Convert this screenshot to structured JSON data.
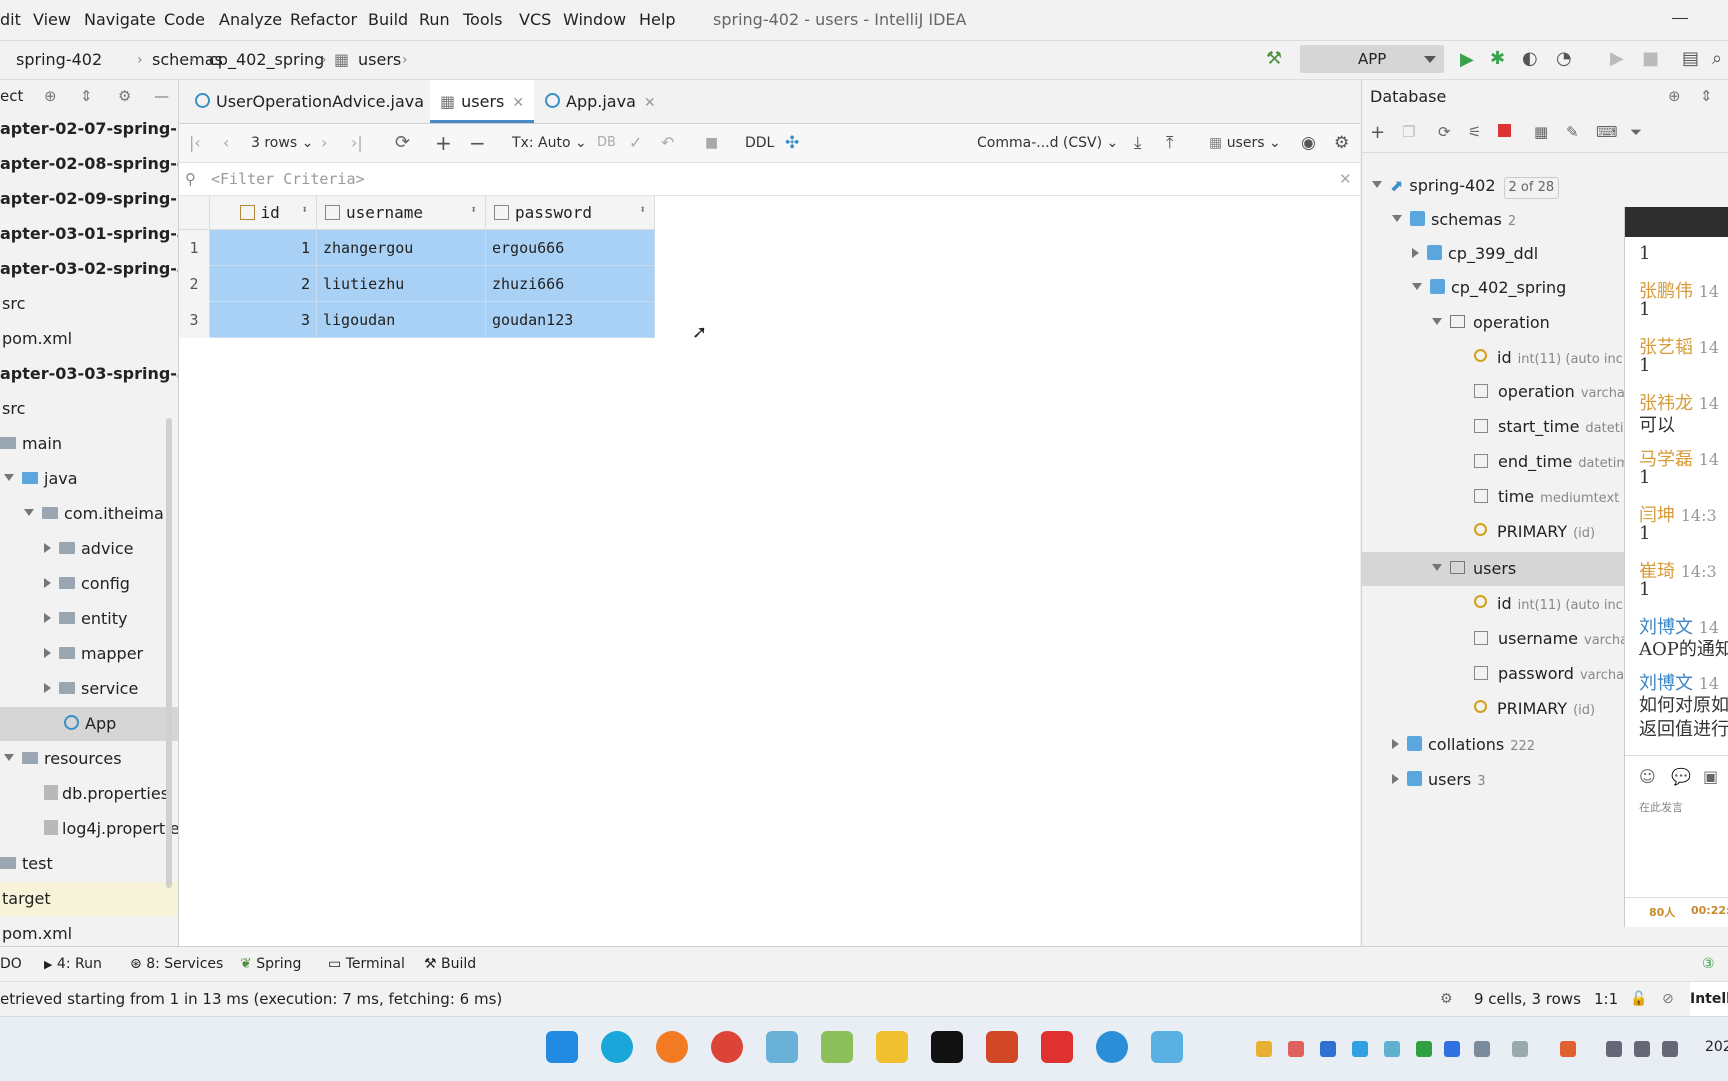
{
  "window": {
    "title": "spring-402 - users - IntelliJ IDEA"
  },
  "menu": [
    "dit",
    "View",
    "Navigate",
    "Code",
    "Analyze",
    "Refactor",
    "Build",
    "Run",
    "Tools",
    "VCS",
    "Window",
    "Help"
  ],
  "breadcrumb": [
    "spring-402",
    "schemas",
    "cp_402_spring",
    "users"
  ],
  "run_config": "APP",
  "project": {
    "header": "ect",
    "items": [
      {
        "label": "apter-02-07-spring-ioc-"
      },
      {
        "label": "apter-02-08-spring-di-a"
      },
      {
        "label": "apter-02-09-spring-myb"
      },
      {
        "label": "apter-03-01-spring-aop"
      },
      {
        "label": "apter-03-02-spring-aop"
      },
      {
        "label": "src"
      },
      {
        "label": "pom.xml"
      },
      {
        "label": "apter-03-03-spring-aop"
      },
      {
        "label": "src"
      },
      {
        "label": "main"
      },
      {
        "label": "java"
      },
      {
        "label": "com.itheima"
      },
      {
        "label": "advice"
      },
      {
        "label": "config"
      },
      {
        "label": "entity"
      },
      {
        "label": "mapper"
      },
      {
        "label": "service"
      },
      {
        "label": "App"
      },
      {
        "label": "resources"
      },
      {
        "label": "db.properties"
      },
      {
        "label": "log4j.properties"
      },
      {
        "label": "test"
      },
      {
        "label": "target"
      },
      {
        "label": "pom.xml"
      }
    ]
  },
  "tabs": [
    {
      "label": "UserOperationAdvice.java"
    },
    {
      "label": "users"
    },
    {
      "label": "App.java"
    }
  ],
  "grid_toolbar": {
    "rows": "3 rows",
    "tx": "Tx: Auto",
    "ddl": "DDL",
    "format": "Comma-...d (CSV)",
    "table": "users"
  },
  "filter": {
    "placeholder": "<Filter Criteria>"
  },
  "table": {
    "columns": [
      "id",
      "username",
      "password"
    ],
    "rows": [
      {
        "n": "1",
        "id": "1",
        "username": "zhangergou",
        "password": "ergou666"
      },
      {
        "n": "2",
        "id": "2",
        "username": "liutiezhu",
        "password": "zhuzi666"
      },
      {
        "n": "3",
        "id": "3",
        "username": "ligoudan",
        "password": "goudan123"
      }
    ]
  },
  "database": {
    "title": "Database",
    "root": "spring-402",
    "root_badge": "2 of 28",
    "schemas": "schemas",
    "schemas_count": "2",
    "schema1": "cp_399_ddl",
    "schema2": "cp_402_spring",
    "t_operation": "operation",
    "op_cols": [
      {
        "name": "id",
        "type": "int(11) (auto inc"
      },
      {
        "name": "operation",
        "type": "varcha"
      },
      {
        "name": "start_time",
        "type": "datetim"
      },
      {
        "name": "end_time",
        "type": "datetim"
      },
      {
        "name": "time",
        "type": "mediumtext"
      },
      {
        "name": "PRIMARY",
        "type": "(id)"
      }
    ],
    "t_users": "users",
    "users_cols": [
      {
        "name": "id",
        "type": "int(11) (auto inc"
      },
      {
        "name": "username",
        "type": "varcha"
      },
      {
        "name": "password",
        "type": "varcha"
      },
      {
        "name": "PRIMARY",
        "type": "(id)"
      }
    ],
    "collations": "collations",
    "collations_count": "222",
    "users_root": "users",
    "users_root_count": "3"
  },
  "chat": {
    "messages": [
      {
        "name": "",
        "time": "",
        "text": "1"
      },
      {
        "name": "张鹏伟",
        "time": "14",
        "text": "1"
      },
      {
        "name": "张艺韬",
        "time": "14",
        "text": "1"
      },
      {
        "name": "张祎龙",
        "time": "14",
        "text": "可以"
      },
      {
        "name": "马学磊",
        "time": "14",
        "text": "1"
      },
      {
        "name": "闫坤",
        "time": "14:3",
        "text": "1"
      },
      {
        "name": "崔琦",
        "time": "14:3",
        "text": "1"
      },
      {
        "name": "刘博文",
        "time": "14",
        "text": "AOP的通知"
      },
      {
        "name": "刘博文",
        "time": "14",
        "text": "如何对原如"
      },
      {
        "name": "",
        "time": "",
        "text": "返回值进行"
      }
    ],
    "input_placeholder": "在此发言",
    "people": "80人",
    "duration": "00:22:1"
  },
  "bottom_tools": [
    {
      "label": "DO"
    },
    {
      "label": "4: Run"
    },
    {
      "label": "8: Services"
    },
    {
      "label": "Spring"
    },
    {
      "label": "Terminal"
    },
    {
      "label": "Build"
    }
  ],
  "status": {
    "message": "etrieved starting from 1 in 13 ms (execution: 7 ms, fetching: 6 ms)",
    "selection": "9 cells, 3 rows",
    "position": "1:1",
    "intellij": "Intelli"
  },
  "taskbar": {
    "clock": "202"
  },
  "colors": {
    "selection": "#a9d1f5",
    "accent": "#4a88c7",
    "folder": "#5aa6df"
  }
}
